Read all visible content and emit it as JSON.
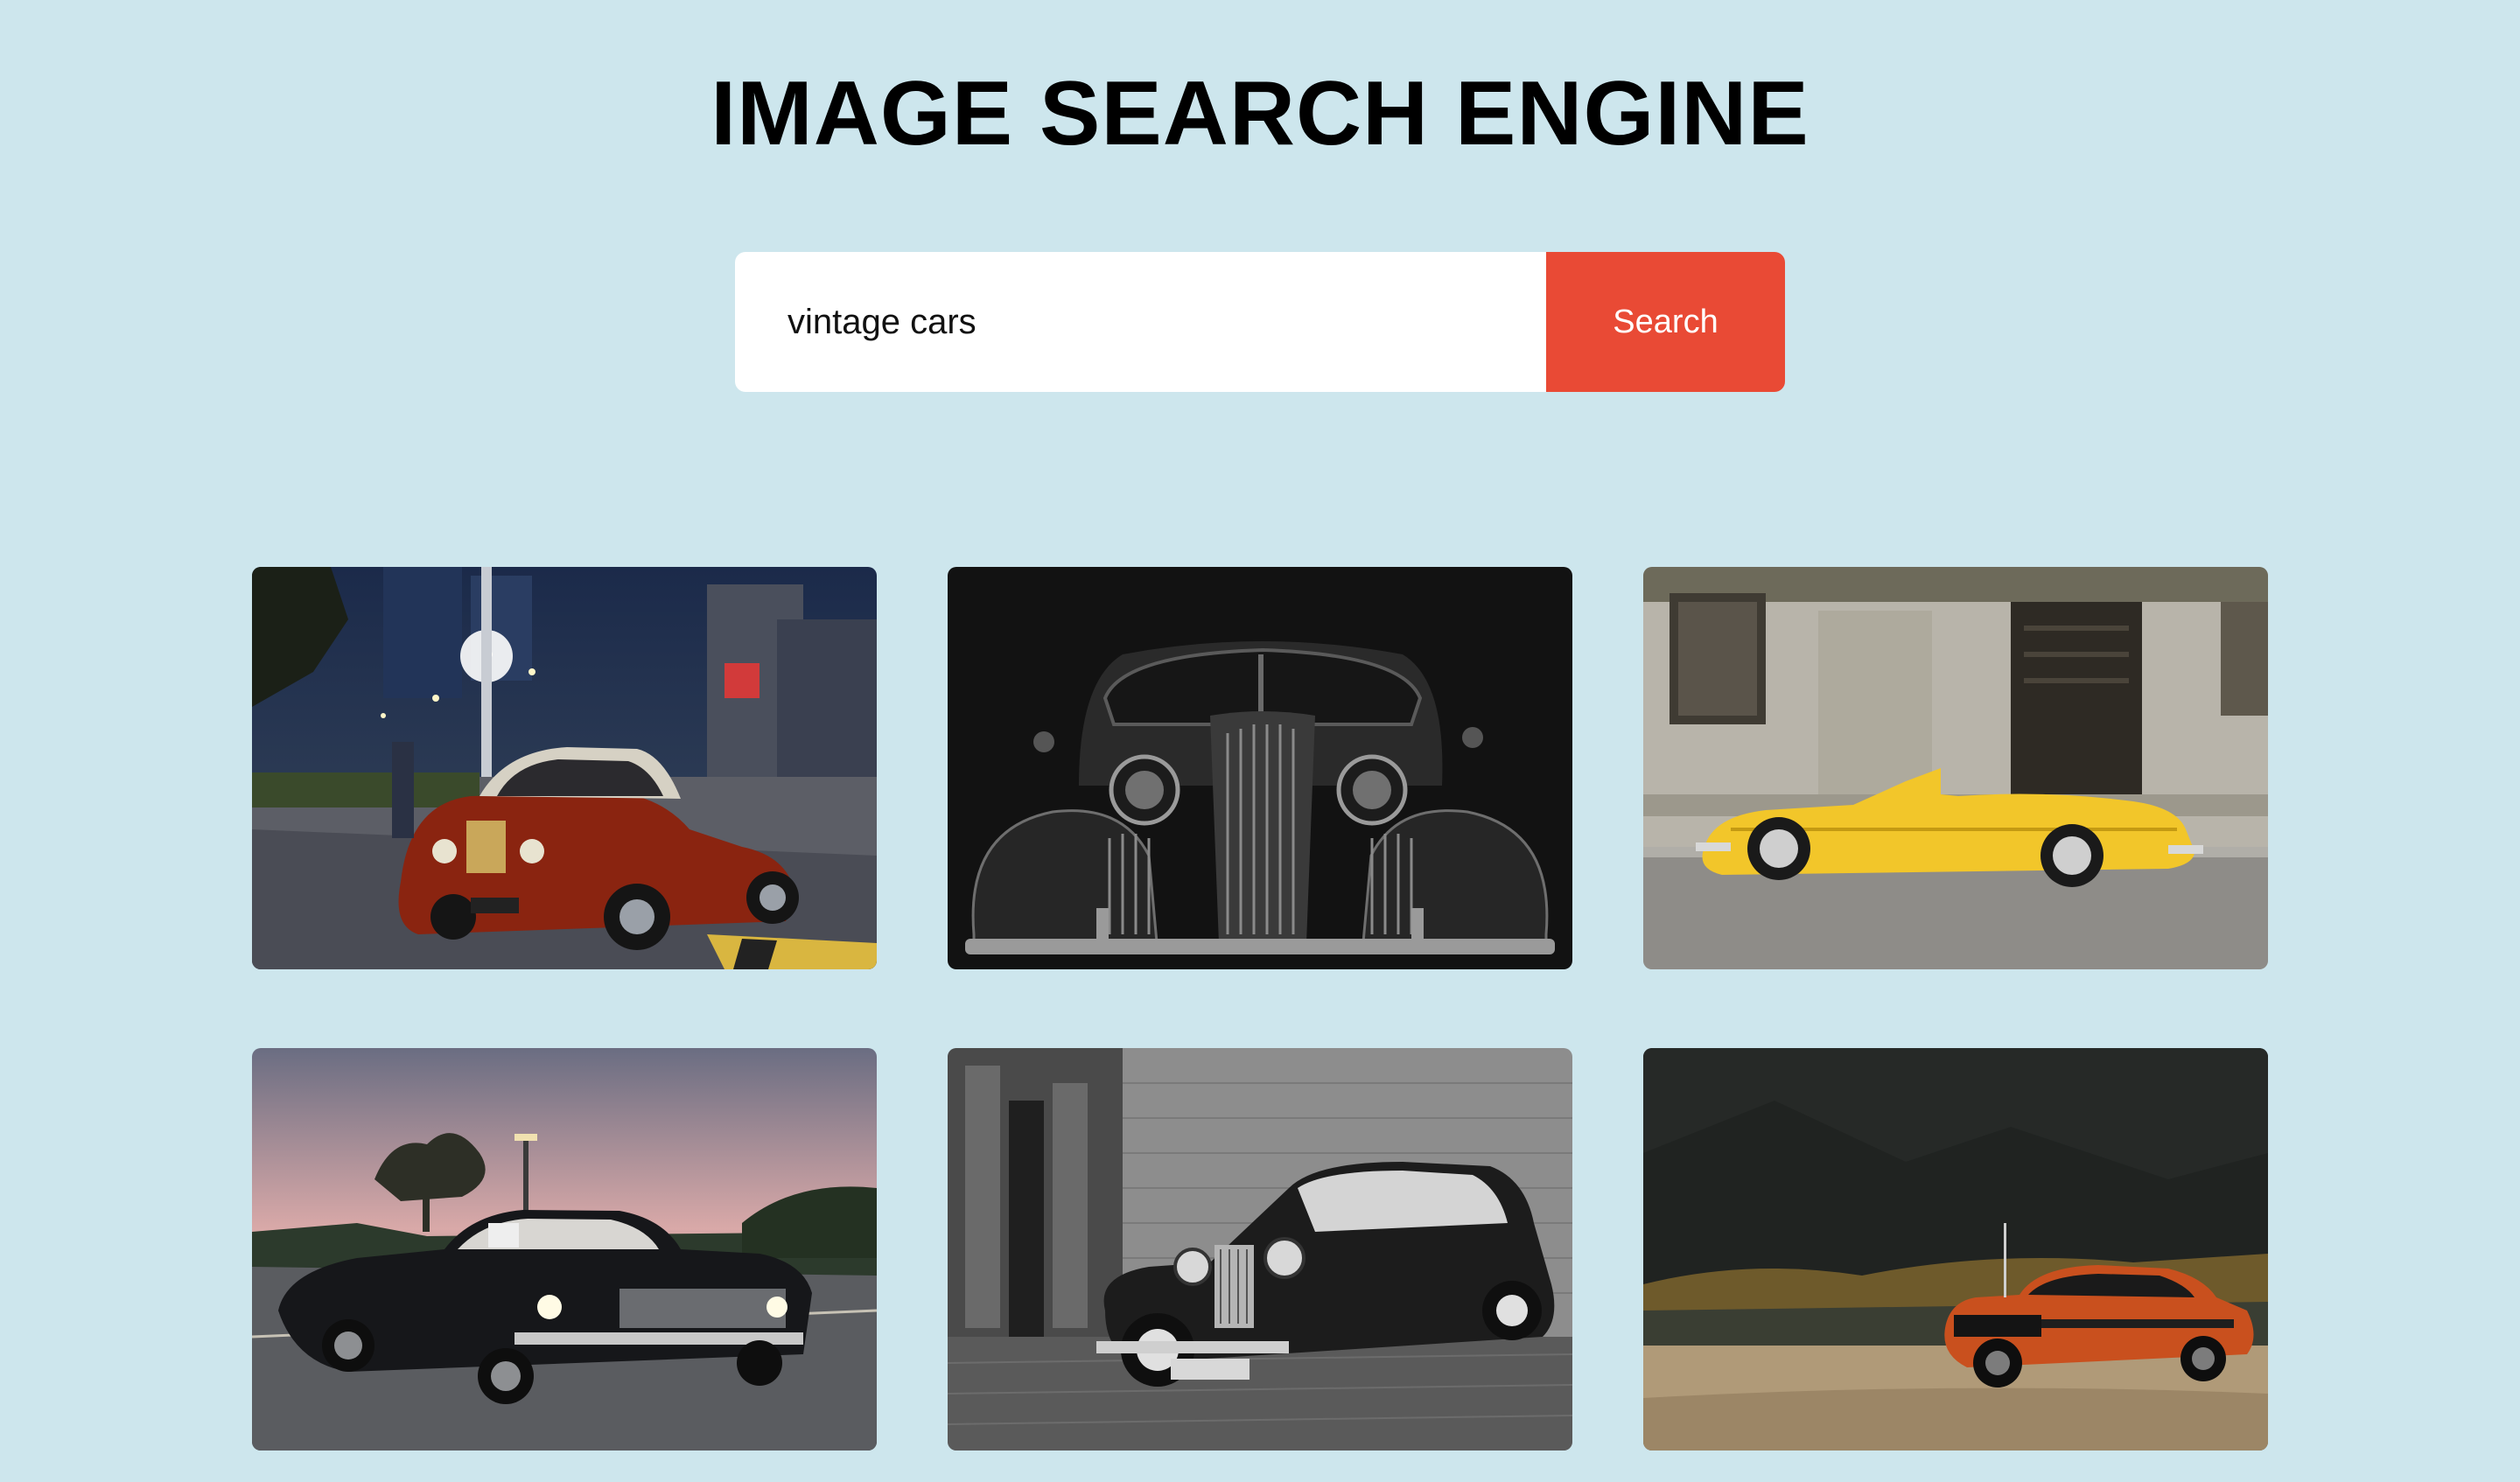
{
  "header": {
    "title": "IMAGE SEARCH ENGINE"
  },
  "search": {
    "value": "vintage cars",
    "placeholder": "",
    "button_label": "Search"
  },
  "colors": {
    "background": "#cde6ed",
    "accent": "#e94a35",
    "input_bg": "#ffffff"
  },
  "results": [
    {
      "subject": "red-classic-car-night-street-photo",
      "tone": "color"
    },
    {
      "subject": "black-vintage-car-front-photo",
      "tone": "monochrome"
    },
    {
      "subject": "yellow-convertible-old-building-photo",
      "tone": "color"
    },
    {
      "subject": "black-sedan-dusk-photo",
      "tone": "color"
    },
    {
      "subject": "antique-car-stone-building-photo",
      "tone": "monochrome"
    },
    {
      "subject": "orange-muscle-car-mountains-photo",
      "tone": "color"
    }
  ]
}
